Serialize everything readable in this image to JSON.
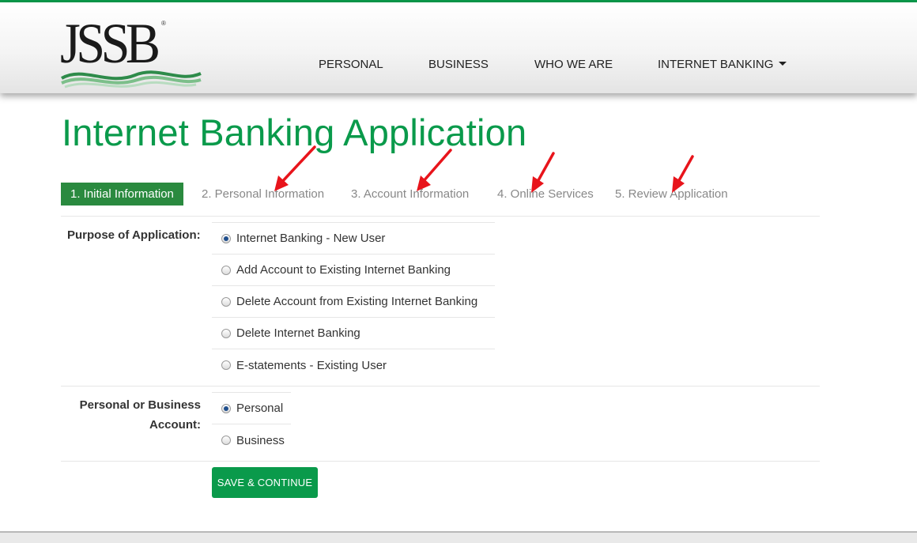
{
  "logo": {
    "text": "JSSB",
    "reg": "®"
  },
  "nav": {
    "items": [
      {
        "label": "PERSONAL"
      },
      {
        "label": "BUSINESS"
      },
      {
        "label": "WHO WE ARE"
      },
      {
        "label": "INTERNET BANKING"
      }
    ]
  },
  "page": {
    "title": "Internet Banking Application"
  },
  "steps": [
    {
      "label": "1. Initial Information",
      "active": true
    },
    {
      "label": "2. Personal Information",
      "active": false
    },
    {
      "label": "3. Account Information",
      "active": false
    },
    {
      "label": "4. Online Services",
      "active": false
    },
    {
      "label": "5. Review Application",
      "active": false
    }
  ],
  "form": {
    "purpose": {
      "label": "Purpose of Application:",
      "options": [
        {
          "label": "Internet Banking - New User",
          "checked": true
        },
        {
          "label": "Add Account to Existing Internet Banking",
          "checked": false
        },
        {
          "label": "Delete Account from Existing Internet Banking",
          "checked": false
        },
        {
          "label": "Delete Internet Banking",
          "checked": false
        },
        {
          "label": "E-statements - Existing User",
          "checked": false
        }
      ]
    },
    "account_type": {
      "label_line1": "Personal or Business",
      "label_line2": "Account:",
      "options": [
        {
          "label": "Personal",
          "checked": true
        },
        {
          "label": "Business",
          "checked": false
        }
      ]
    },
    "save_label": "SAVE & CONTINUE"
  },
  "colors": {
    "brand_green": "#0a9a4b",
    "active_step": "#2a8a3f",
    "annotation_arrow": "#e8141b"
  }
}
